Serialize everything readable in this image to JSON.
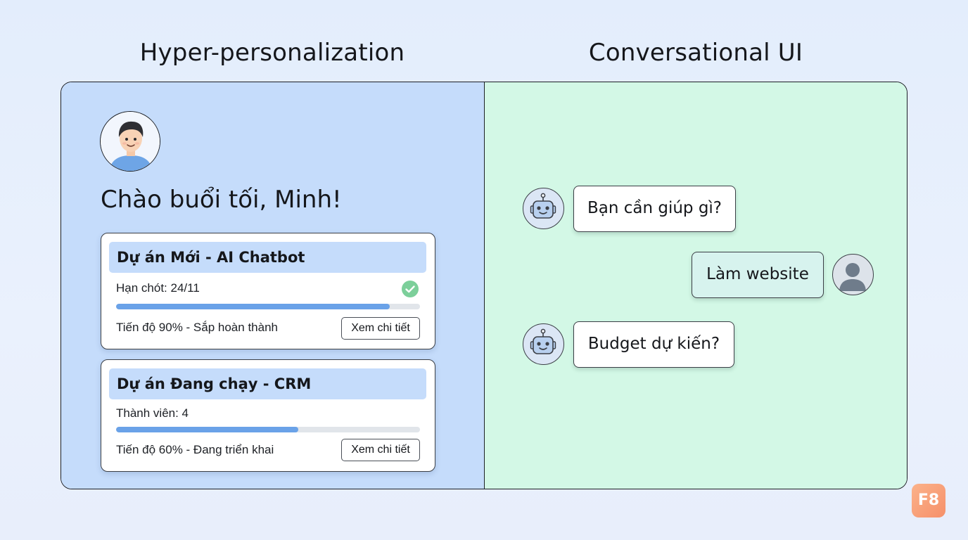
{
  "headings": {
    "left": "Hyper-personalization",
    "right": "Conversational UI"
  },
  "personalization": {
    "greeting": "Chào buổi tối, Minh!",
    "cards": [
      {
        "title": "Dự án Mới - AI Chatbot",
        "meta": "Hạn chót: 24/11",
        "progress": 0.9,
        "status": "Tiến độ 90% - Sắp hoàn thành",
        "button": "Xem chi tiết"
      },
      {
        "title": "Dự án Đang chạy - CRM",
        "meta": "Thành viên: 4",
        "progress": 0.6,
        "status": "Tiến độ 60% - Đang triển khai",
        "button": "Xem chi tiết"
      }
    ]
  },
  "chat": {
    "messages": [
      {
        "from": "bot",
        "text": "Bạn cần giúp gì?"
      },
      {
        "from": "user",
        "text": "Làm website"
      },
      {
        "from": "bot",
        "text": "Budget dự kiến?"
      }
    ]
  },
  "brand": {
    "logo": "F8",
    "logo_color": "#f6906a"
  },
  "colors": {
    "left_panel": "#c5dcfb",
    "right_panel": "#d3f8e6",
    "progress": "#6aa2e8",
    "check": "#7ccf9a"
  },
  "icons": [
    "user-avatar-icon",
    "check-circle-icon",
    "robot-icon",
    "person-icon"
  ]
}
